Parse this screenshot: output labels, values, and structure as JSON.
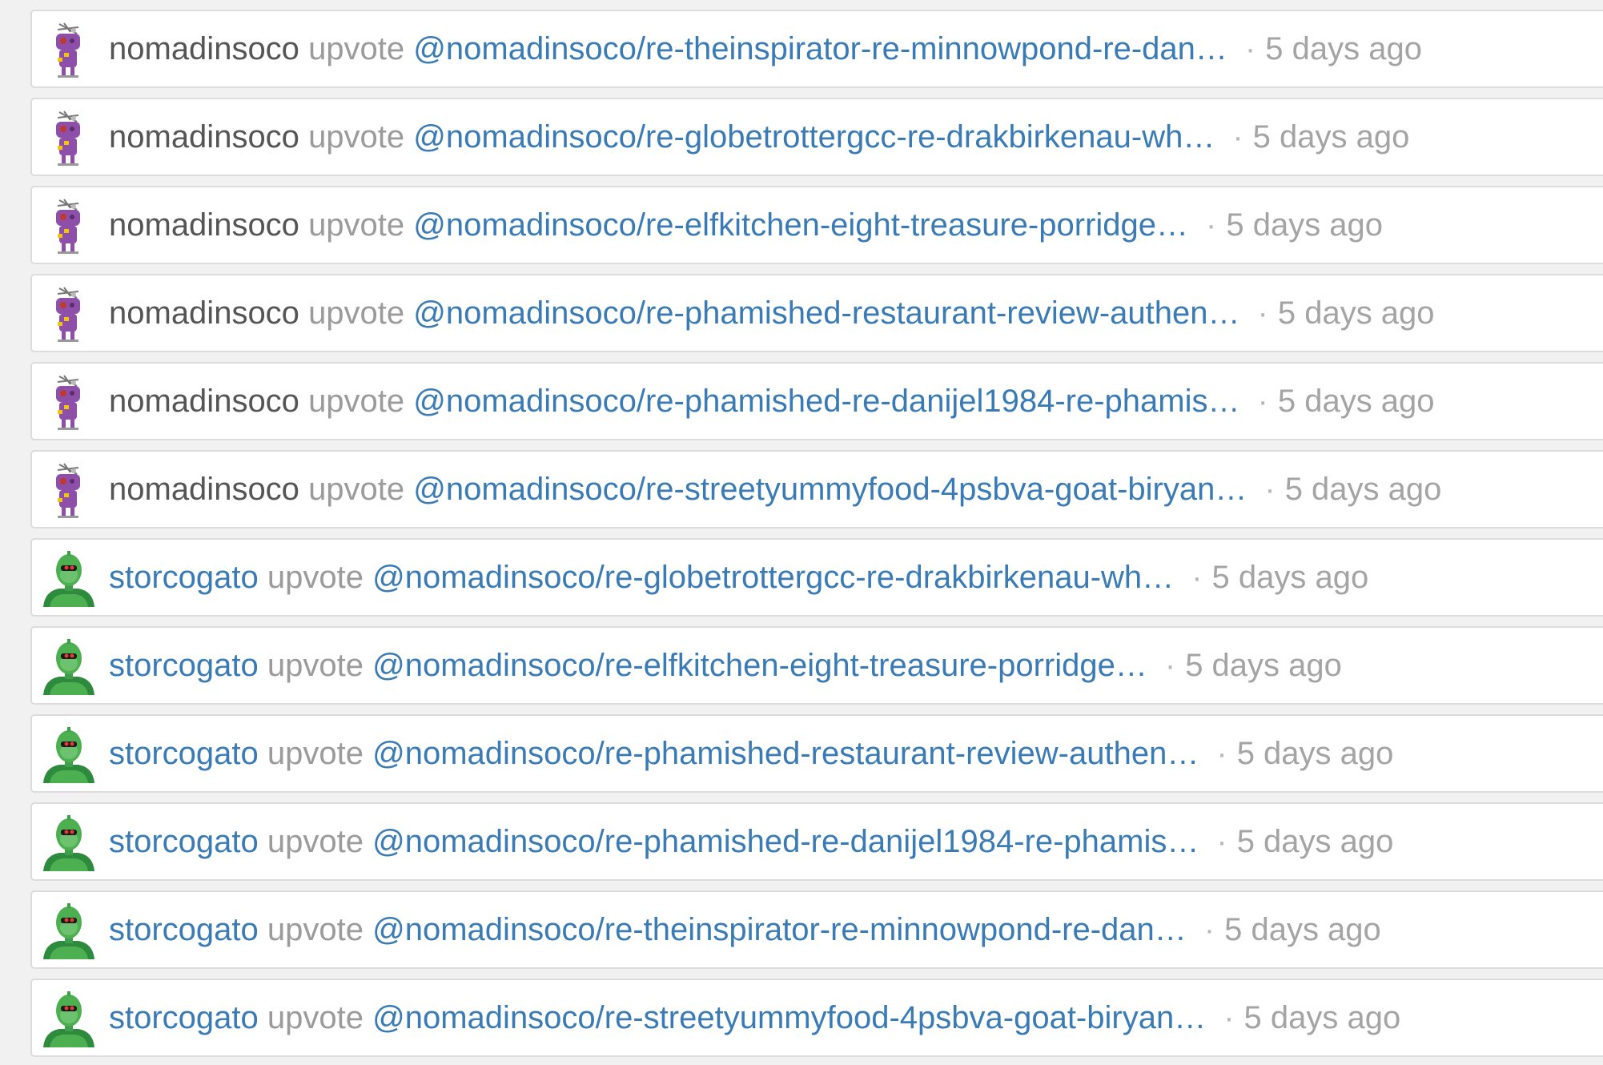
{
  "colors": {
    "page_background": "#f1f1f1",
    "row_background": "#ffffff",
    "row_border": "#dcdcdc",
    "account_dark": "#555555",
    "link_blue": "#3a7bb5",
    "action_gray": "#9b9b9b",
    "time_gray": "#a4a4a4",
    "avatar_purple": "#8e4fa8",
    "avatar_green": "#4caf50"
  },
  "separator": "·",
  "activity": [
    {
      "account": "nomadinsoco",
      "action": "upvote",
      "permlink": "@nomadinsoco/re-theinspirator-re-minnowpond-re-dan…",
      "time": "5 days ago",
      "avatar_icon": "purple-robot-avatar-icon"
    },
    {
      "account": "nomadinsoco",
      "action": "upvote",
      "permlink": "@nomadinsoco/re-globetrottergcc-re-drakbirkenau-wh…",
      "time": "5 days ago",
      "avatar_icon": "purple-robot-avatar-icon"
    },
    {
      "account": "nomadinsoco",
      "action": "upvote",
      "permlink": "@nomadinsoco/re-elfkitchen-eight-treasure-porridge…",
      "time": "5 days ago",
      "avatar_icon": "purple-robot-avatar-icon"
    },
    {
      "account": "nomadinsoco",
      "action": "upvote",
      "permlink": "@nomadinsoco/re-phamished-restaurant-review-authen…",
      "time": "5 days ago",
      "avatar_icon": "purple-robot-avatar-icon"
    },
    {
      "account": "nomadinsoco",
      "action": "upvote",
      "permlink": "@nomadinsoco/re-phamished-re-danijel1984-re-phamis…",
      "time": "5 days ago",
      "avatar_icon": "purple-robot-avatar-icon"
    },
    {
      "account": "nomadinsoco",
      "action": "upvote",
      "permlink": "@nomadinsoco/re-streetyummyfood-4psbva-goat-biryan…",
      "time": "5 days ago",
      "avatar_icon": "purple-robot-avatar-icon"
    },
    {
      "account": "storcogato",
      "action": "upvote",
      "permlink": "@nomadinsoco/re-globetrottergcc-re-drakbirkenau-wh…",
      "time": "5 days ago",
      "avatar_icon": "green-alien-avatar-icon"
    },
    {
      "account": "storcogato",
      "action": "upvote",
      "permlink": "@nomadinsoco/re-elfkitchen-eight-treasure-porridge…",
      "time": "5 days ago",
      "avatar_icon": "green-alien-avatar-icon"
    },
    {
      "account": "storcogato",
      "action": "upvote",
      "permlink": "@nomadinsoco/re-phamished-restaurant-review-authen…",
      "time": "5 days ago",
      "avatar_icon": "green-alien-avatar-icon"
    },
    {
      "account": "storcogato",
      "action": "upvote",
      "permlink": "@nomadinsoco/re-phamished-re-danijel1984-re-phamis…",
      "time": "5 days ago",
      "avatar_icon": "green-alien-avatar-icon"
    },
    {
      "account": "storcogato",
      "action": "upvote",
      "permlink": "@nomadinsoco/re-theinspirator-re-minnowpond-re-dan…",
      "time": "5 days ago",
      "avatar_icon": "green-alien-avatar-icon"
    },
    {
      "account": "storcogato",
      "action": "upvote",
      "permlink": "@nomadinsoco/re-streetyummyfood-4psbva-goat-biryan…",
      "time": "5 days ago",
      "avatar_icon": "green-alien-avatar-icon"
    }
  ]
}
